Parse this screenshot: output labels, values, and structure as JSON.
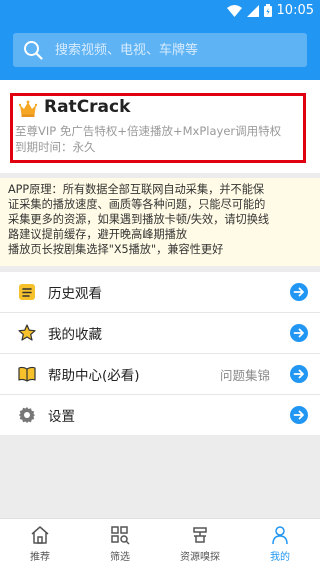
{
  "status_bar": {
    "time": "10:05"
  },
  "search": {
    "placeholder": "搜索视频、电视、车牌等"
  },
  "profile": {
    "username": "RatCrack",
    "privileges": "至尊VIP 免广告特权+倍速播放+MxPlayer调用特权",
    "expiry": "到期时间：永久"
  },
  "notice": {
    "lines": [
      "APP原理：所有数据全部互联网自动采集，并不能保",
      "证采集的播放速度、画质等各种问题，只能尽可能的",
      "采集更多的资源，如果遇到播放卡顿/失效，请切换线",
      "路建议提前缓存，避开晚高峰期播放",
      "播放页长按剧集选择\"X5播放\"，兼容性更好"
    ]
  },
  "menu": {
    "history": "历史观看",
    "favorites": "我的收藏",
    "help": "帮助中心(必看)",
    "help_extra": "问题集锦",
    "settings": "设置"
  },
  "bottom_nav": {
    "tabs": [
      {
        "label": "推荐"
      },
      {
        "label": "筛选"
      },
      {
        "label": "资源嗅探"
      },
      {
        "label": "我的"
      }
    ],
    "active_index": 3
  },
  "colors": {
    "primary": "#2196f3",
    "highlight_border": "#e00010",
    "notice_bg": "#fffbe6"
  }
}
